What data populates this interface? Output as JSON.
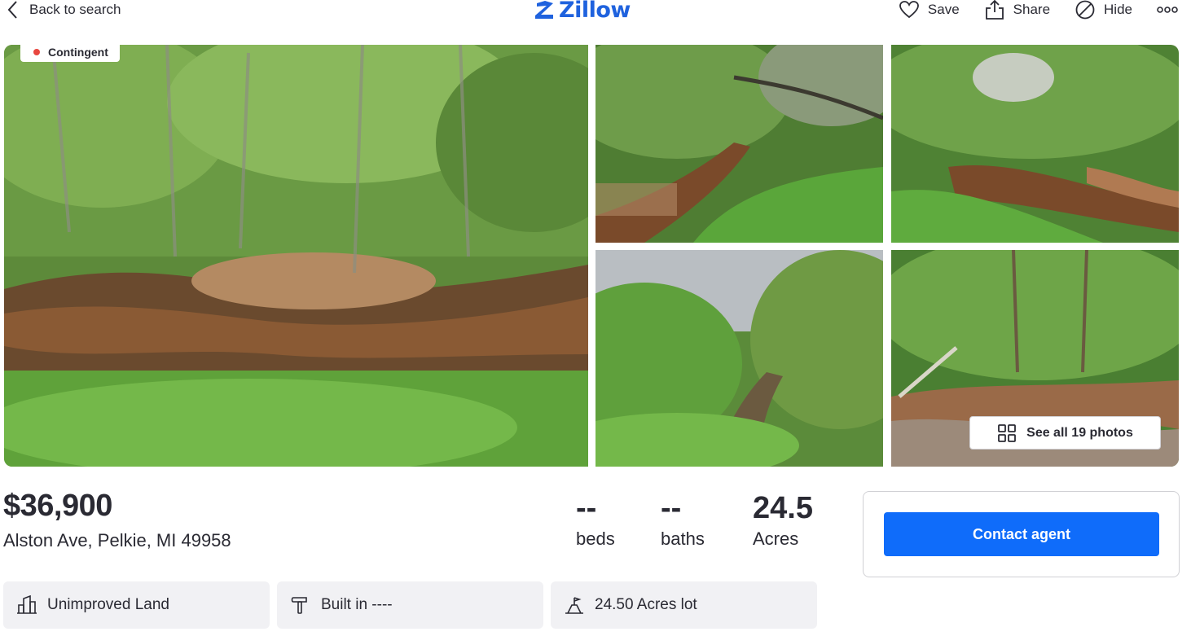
{
  "header": {
    "back_label": "Back to search",
    "logo_text": "Zillow",
    "actions": [
      {
        "label": "Save",
        "icon": "heart-icon"
      },
      {
        "label": "Share",
        "icon": "share-icon"
      },
      {
        "label": "Hide",
        "icon": "hide-icon"
      }
    ],
    "more_icon": "more-icon"
  },
  "photos": {
    "status_badge": "Contingent",
    "see_all_label": "See all 19 photos"
  },
  "listing": {
    "price": "$36,900",
    "address": "Alston Ave, Pelkie, MI 49958",
    "stats": [
      {
        "value": "--",
        "label": "beds"
      },
      {
        "value": "--",
        "label": "baths"
      },
      {
        "value": "24.5",
        "label": "Acres"
      }
    ]
  },
  "contact": {
    "button_label": "Contact agent"
  },
  "facts": [
    {
      "label": "Unimproved Land",
      "icon": "building-icon"
    },
    {
      "label": "Built in ----",
      "icon": "hammer-icon"
    },
    {
      "label": "24.50 Acres lot",
      "icon": "lot-icon"
    }
  ],
  "colors": {
    "accent": "#0f6cfa",
    "logo": "#1f62de",
    "status": "#e8473f"
  }
}
